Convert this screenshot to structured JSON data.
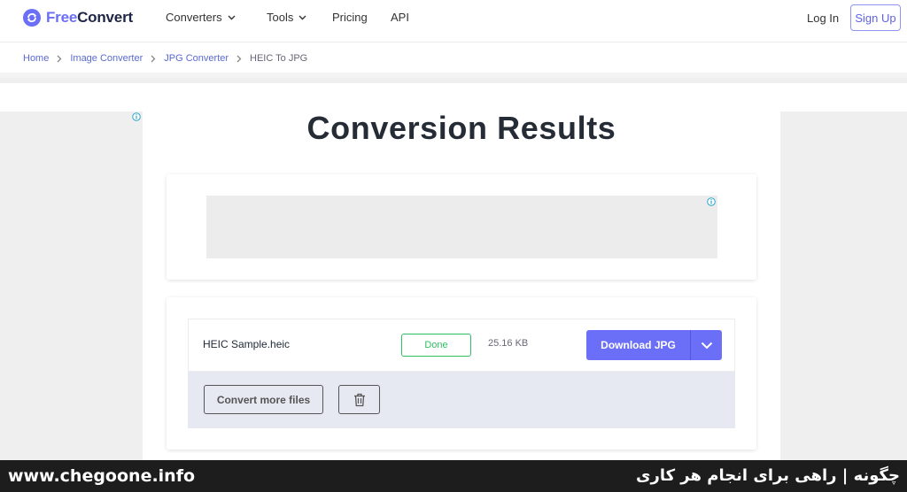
{
  "header": {
    "logo_free": "Free",
    "logo_convert": "Convert",
    "nav": {
      "converters": "Converters",
      "tools": "Tools",
      "pricing": "Pricing",
      "api": "API"
    },
    "login": "Log In",
    "signup": "Sign Up"
  },
  "breadcrumb": {
    "items": [
      "Home",
      "Image Converter",
      "JPG Converter",
      "HEIC To JPG"
    ]
  },
  "page": {
    "title": "Conversion Results"
  },
  "result": {
    "file_name": "HEIC Sample.heic",
    "status": "Done",
    "file_size": "25.16 KB",
    "download_label": "Download JPG",
    "convert_more_label": "Convert more files"
  },
  "footer": {
    "site": "www.chegoone.info",
    "tagline": "چگونه | راهی برای انجام هر کاری"
  },
  "colors": {
    "accent": "#6b6ef6",
    "success": "#2fbf63",
    "footer_bg": "#1d1d1d"
  },
  "icons": [
    "logo-icon",
    "chevron-down-icon",
    "chevron-right-icon",
    "ad-info-icon",
    "trash-icon"
  ]
}
